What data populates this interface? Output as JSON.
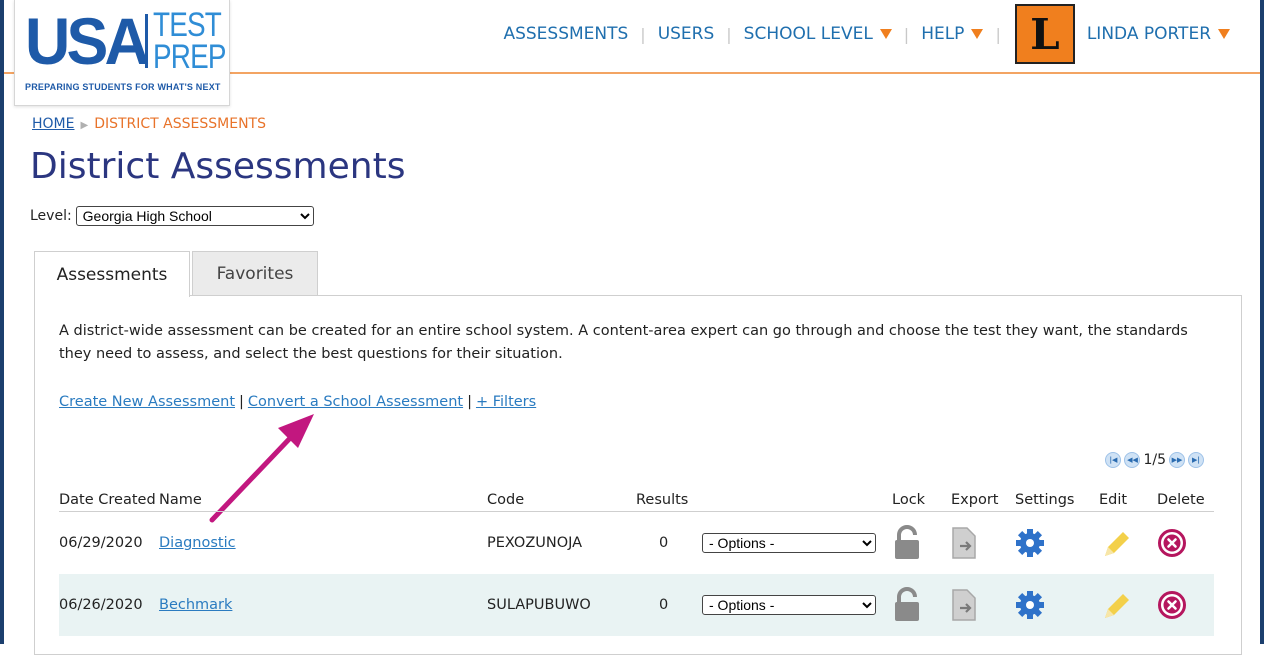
{
  "logo": {
    "main": "USA",
    "test": "TEST",
    "prep": "PREP",
    "tagline": "PREPARING STUDENTS FOR WHAT'S NEXT"
  },
  "nav": {
    "items": [
      "ASSESSMENTS",
      "USERS",
      "SCHOOL LEVEL",
      "HELP"
    ],
    "avatar_letter": "L",
    "user_name": "LINDA PORTER"
  },
  "breadcrumb": {
    "home": "HOME",
    "current": "DISTRICT ASSESSMENTS"
  },
  "page_title": "District Assessments",
  "level": {
    "label": "Level:",
    "selected": "Georgia High School"
  },
  "tabs": [
    "Assessments",
    "Favorites"
  ],
  "description": "A district-wide assessment can be created for an entire school system. A content-area expert can go through and choose the test they want, the standards they need to assess, and select the best questions for their situation.",
  "actions": {
    "create": "Create New Assessment",
    "convert": "Convert a School Assessment",
    "filters": "+ Filters",
    "separator": "|"
  },
  "pager": {
    "page_text": "1/5"
  },
  "table": {
    "headers": [
      "Date Created",
      "Name",
      "Code",
      "Results",
      "Lock",
      "Export",
      "Settings",
      "Edit",
      "Delete"
    ],
    "rows": [
      {
        "date": "06/29/2020",
        "name": "Diagnostic",
        "code": "PEXOZUNOJA",
        "results": "0",
        "options": "- Options -"
      },
      {
        "date": "06/26/2020",
        "name": "Bechmark",
        "code": "SULAPUBUWO",
        "results": "0",
        "options": "- Options -"
      }
    ]
  },
  "colors": {
    "brand_blue": "#1e5aa8",
    "accent_orange": "#f07f1e",
    "title_navy": "#2b3680",
    "link_blue": "#2a7bc0",
    "arrow_magenta": "#c2177f",
    "delete_magenta": "#b5165e",
    "settings_blue": "#2f72c9",
    "edit_yellow": "#f3d04a"
  }
}
